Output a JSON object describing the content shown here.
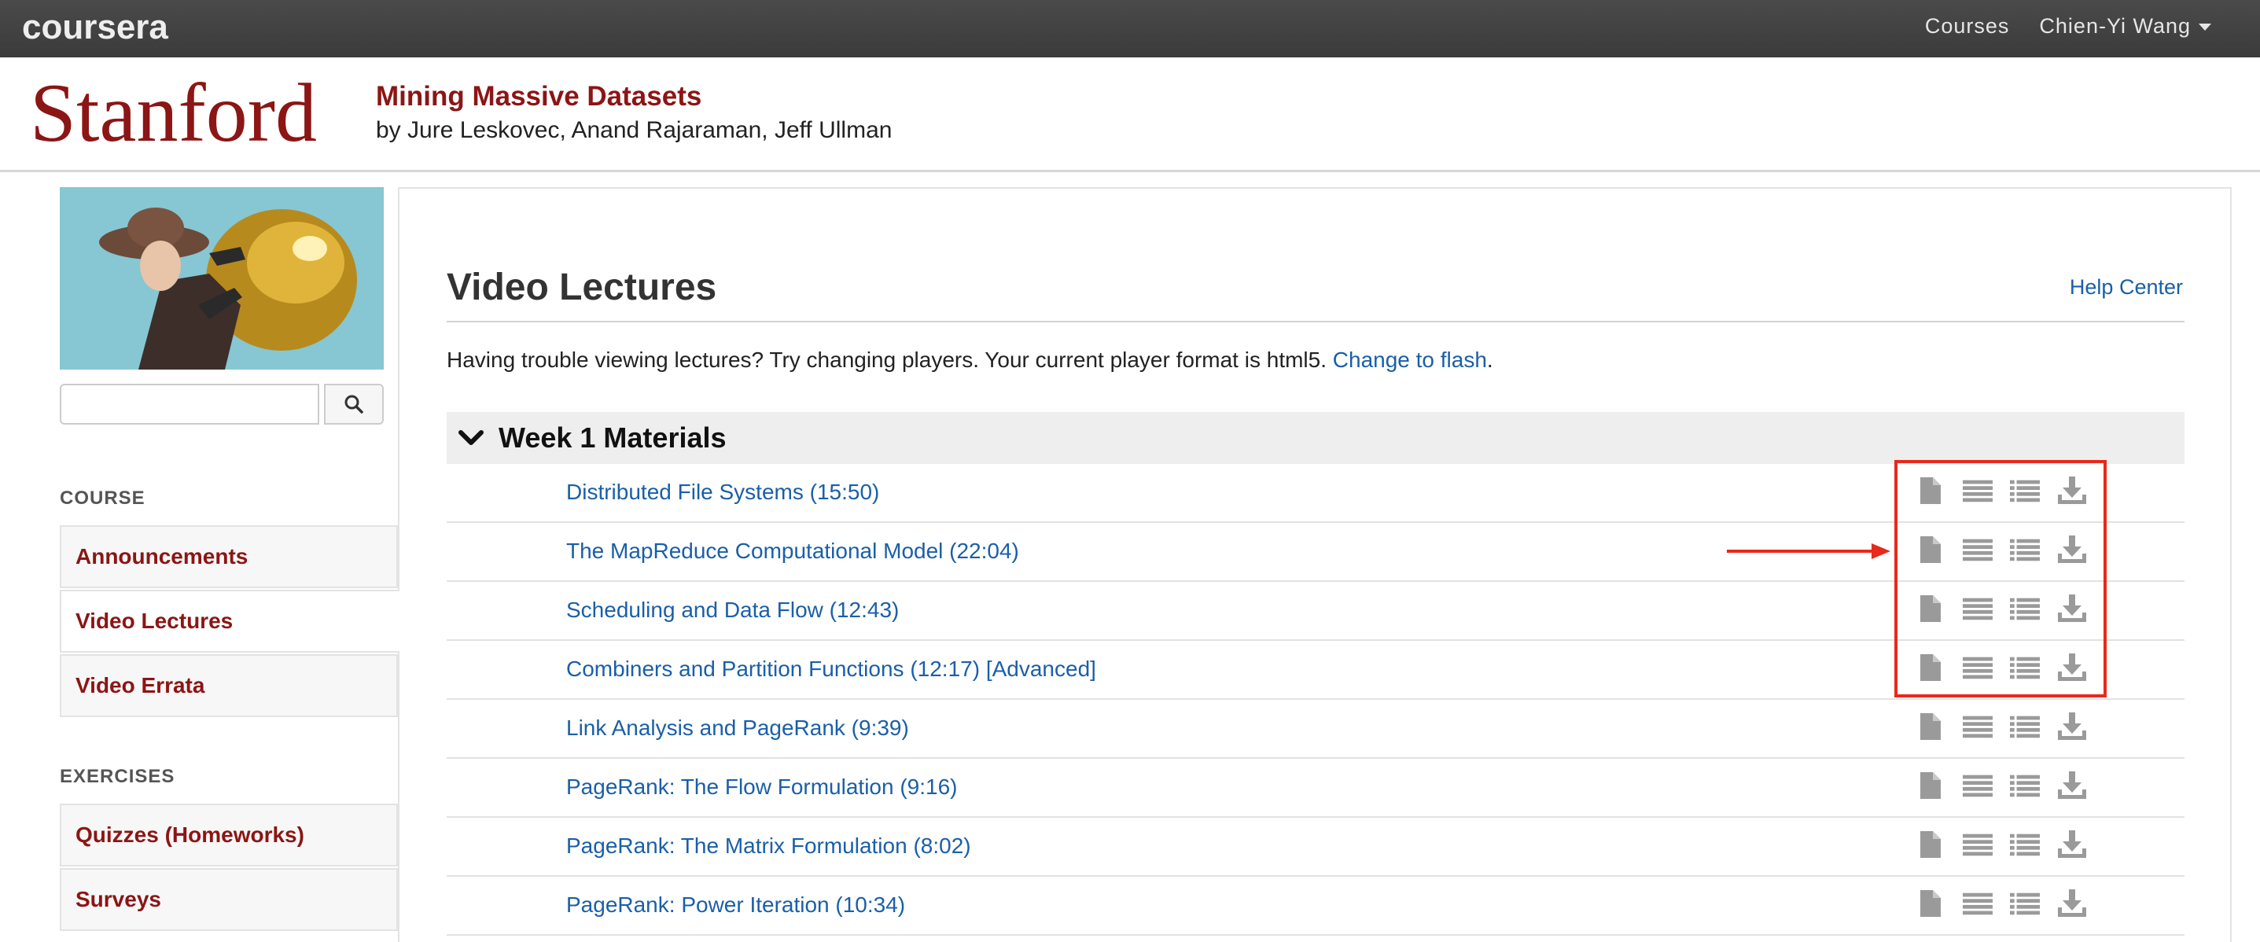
{
  "topbar": {
    "logo": "coursera",
    "nav": {
      "courses": "Courses",
      "user": "Chien-Yi Wang"
    }
  },
  "course": {
    "institution": "Stanford",
    "title": "Mining Massive Datasets",
    "authors": "by Jure Leskovec, Anand Rajaraman, Jeff Ullman"
  },
  "sidebar": {
    "search_placeholder": "",
    "course_label": "COURSE",
    "course_items": [
      {
        "label": "Announcements",
        "active": false
      },
      {
        "label": "Video Lectures",
        "active": true
      },
      {
        "label": "Video Errata",
        "active": false
      }
    ],
    "exercises_label": "EXERCISES",
    "exercise_items": [
      {
        "label": "Quizzes (Homeworks)"
      },
      {
        "label": "Surveys"
      }
    ]
  },
  "main": {
    "title": "Video Lectures",
    "help_link": "Help Center",
    "notice_text": "Having trouble viewing lectures? Try changing players. Your current player format is html5.",
    "notice_link": "Change to flash",
    "notice_end": ".",
    "week_title": "Week 1 Materials",
    "lectures": [
      "Distributed File Systems (15:50)",
      "The MapReduce Computational Model (22:04)",
      "Scheduling and Data Flow (12:43)",
      "Combiners and Partition Functions (12:17) [Advanced]",
      "Link Analysis and PageRank (9:39)",
      "PageRank: The Flow Formulation (9:16)",
      "PageRank: The Matrix Formulation (8:02)",
      "PageRank: Power Iteration (10:34)"
    ],
    "resource_icons": [
      "document-icon",
      "subtitles-icon",
      "transcript-list-icon",
      "download-icon"
    ]
  },
  "colors": {
    "brand_red": "#8c1515",
    "link_blue": "#1a5fa8",
    "annotation_red": "#e8291b",
    "topbar": "#444444"
  }
}
